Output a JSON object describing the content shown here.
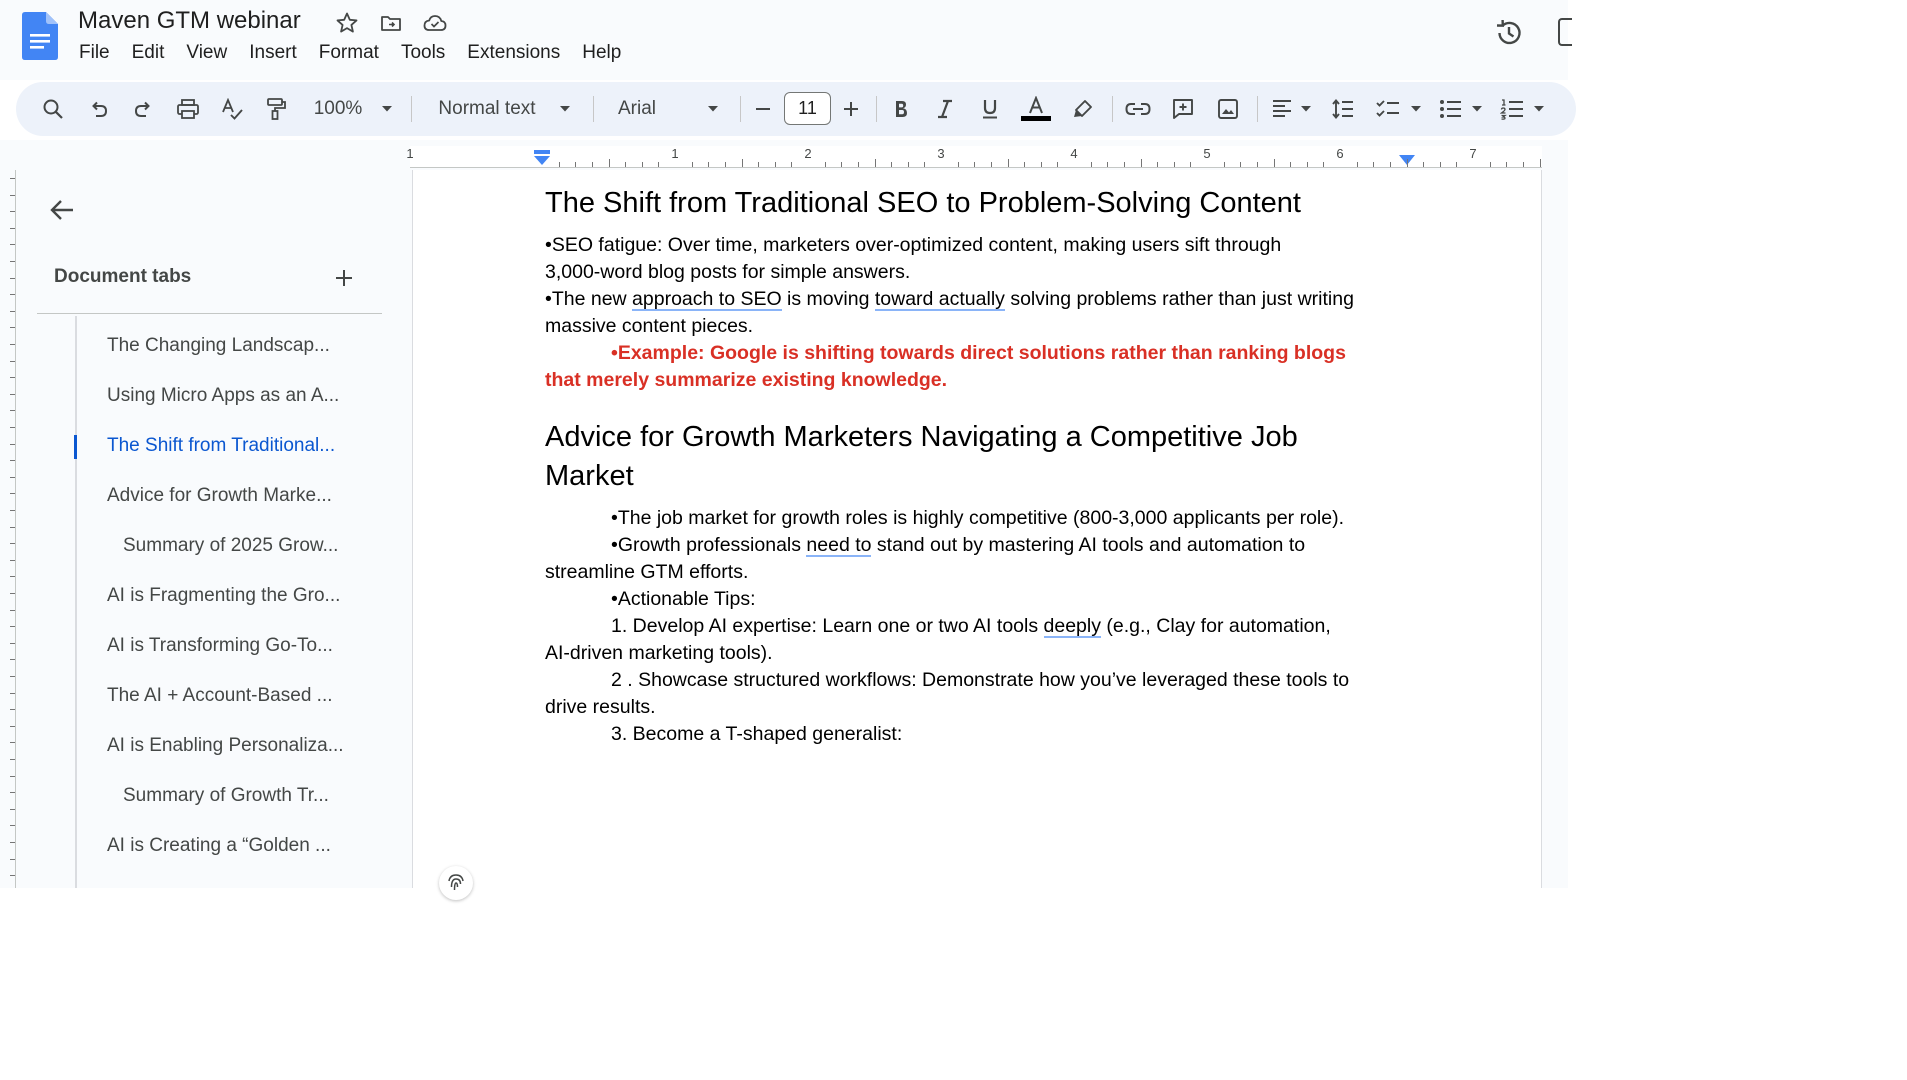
{
  "app": {
    "doc_title": "Maven GTM webinar",
    "menu": [
      "File",
      "Edit",
      "View",
      "Insert",
      "Format",
      "Tools",
      "Extensions",
      "Help"
    ]
  },
  "toolbar": {
    "zoom": "100%",
    "style": "Normal text",
    "font": "Arial",
    "font_size": "11",
    "text_color": "#000000"
  },
  "ruler": {
    "labels": [
      "1",
      "1",
      "2",
      "3",
      "4",
      "5",
      "6",
      "7"
    ]
  },
  "sidebar": {
    "heading": "Document tabs",
    "items": [
      {
        "label": "The Changing Landscap...",
        "level": 1,
        "active": false
      },
      {
        "label": "Using Micro Apps as an A...",
        "level": 1,
        "active": false
      },
      {
        "label": "The Shift from Traditional...",
        "level": 1,
        "active": true
      },
      {
        "label": "Advice for Growth Marke...",
        "level": 1,
        "active": false
      },
      {
        "label": "Summary of 2025 Grow...",
        "level": 2,
        "active": false
      },
      {
        "label": "AI is Fragmenting the Gro...",
        "level": 1,
        "active": false
      },
      {
        "label": "AI is Transforming Go-To...",
        "level": 1,
        "active": false
      },
      {
        "label": "The AI + Account-Based ...",
        "level": 1,
        "active": false
      },
      {
        "label": "AI is Enabling Personaliza...",
        "level": 1,
        "active": false
      },
      {
        "label": "Summary of Growth Tr...",
        "level": 2,
        "active": false
      },
      {
        "label": "AI is Creating a “Golden ...",
        "level": 1,
        "active": false
      }
    ]
  },
  "document": {
    "heading1": "The Shift from Traditional SEO to Problem-Solving Content",
    "b1_l1": "•SEO fatigue: Over time, marketers over-optimized content, making users sift through",
    "b1_l2": "3,000-word blog posts for simple answers.",
    "b2_pre": "•The new ",
    "b2_sq1": "approach to SEO",
    "b2_mid": " is moving ",
    "b2_sq2": "toward actually",
    "b2_post": " solving problems rather than just writing",
    "b2_l2": "massive content pieces.",
    "ex_l1": "•Example: Google is shifting towards direct solutions rather than ranking blogs",
    "ex_l2": "that merely summarize existing knowledge.",
    "heading2_l1": "Advice for Growth Marketers Navigating a Competitive Job",
    "heading2_l2": "Market",
    "j1": "•The job market for growth roles is highly competitive (800-3,000 applicants per role).",
    "j2_pre": "•Growth professionals ",
    "j2_sq": "need to",
    "j2_post": " stand out by mastering AI tools and automation to",
    "j2_l2": "streamline GTM efforts.",
    "j3": "•Actionable Tips:",
    "t1_pre": "1. Develop AI expertise: Learn one or two AI tools ",
    "t1_sq": "deeply",
    "t1_post": " (e.g., Clay for automation,",
    "t1_l2": "AI-driven marketing tools).",
    "t2": "2 . Showcase structured workflows: Demonstrate how you’ve leveraged these tools to",
    "t2_l2": "drive results.",
    "t3": "3. Become a T-shaped generalist:"
  },
  "colors": {
    "accent_blue": "#0b57d0",
    "example_red": "#d93025",
    "toolbar_bg": "#edf2fa"
  },
  "icons": [
    "docs-logo-icon",
    "star-icon",
    "move-to-folder-icon",
    "cloud-saved-icon",
    "version-history-icon",
    "search-icon",
    "undo-icon",
    "redo-icon",
    "print-icon",
    "spellcheck-icon",
    "paint-format-icon",
    "bold-icon",
    "italic-icon",
    "underline-icon",
    "text-color-icon",
    "highlight-icon",
    "link-icon",
    "add-comment-icon",
    "insert-image-icon",
    "align-icon",
    "line-spacing-icon",
    "checklist-icon",
    "bulleted-list-icon",
    "numbered-list-icon",
    "back-arrow-icon",
    "plus-icon",
    "fingerprint-icon"
  ]
}
